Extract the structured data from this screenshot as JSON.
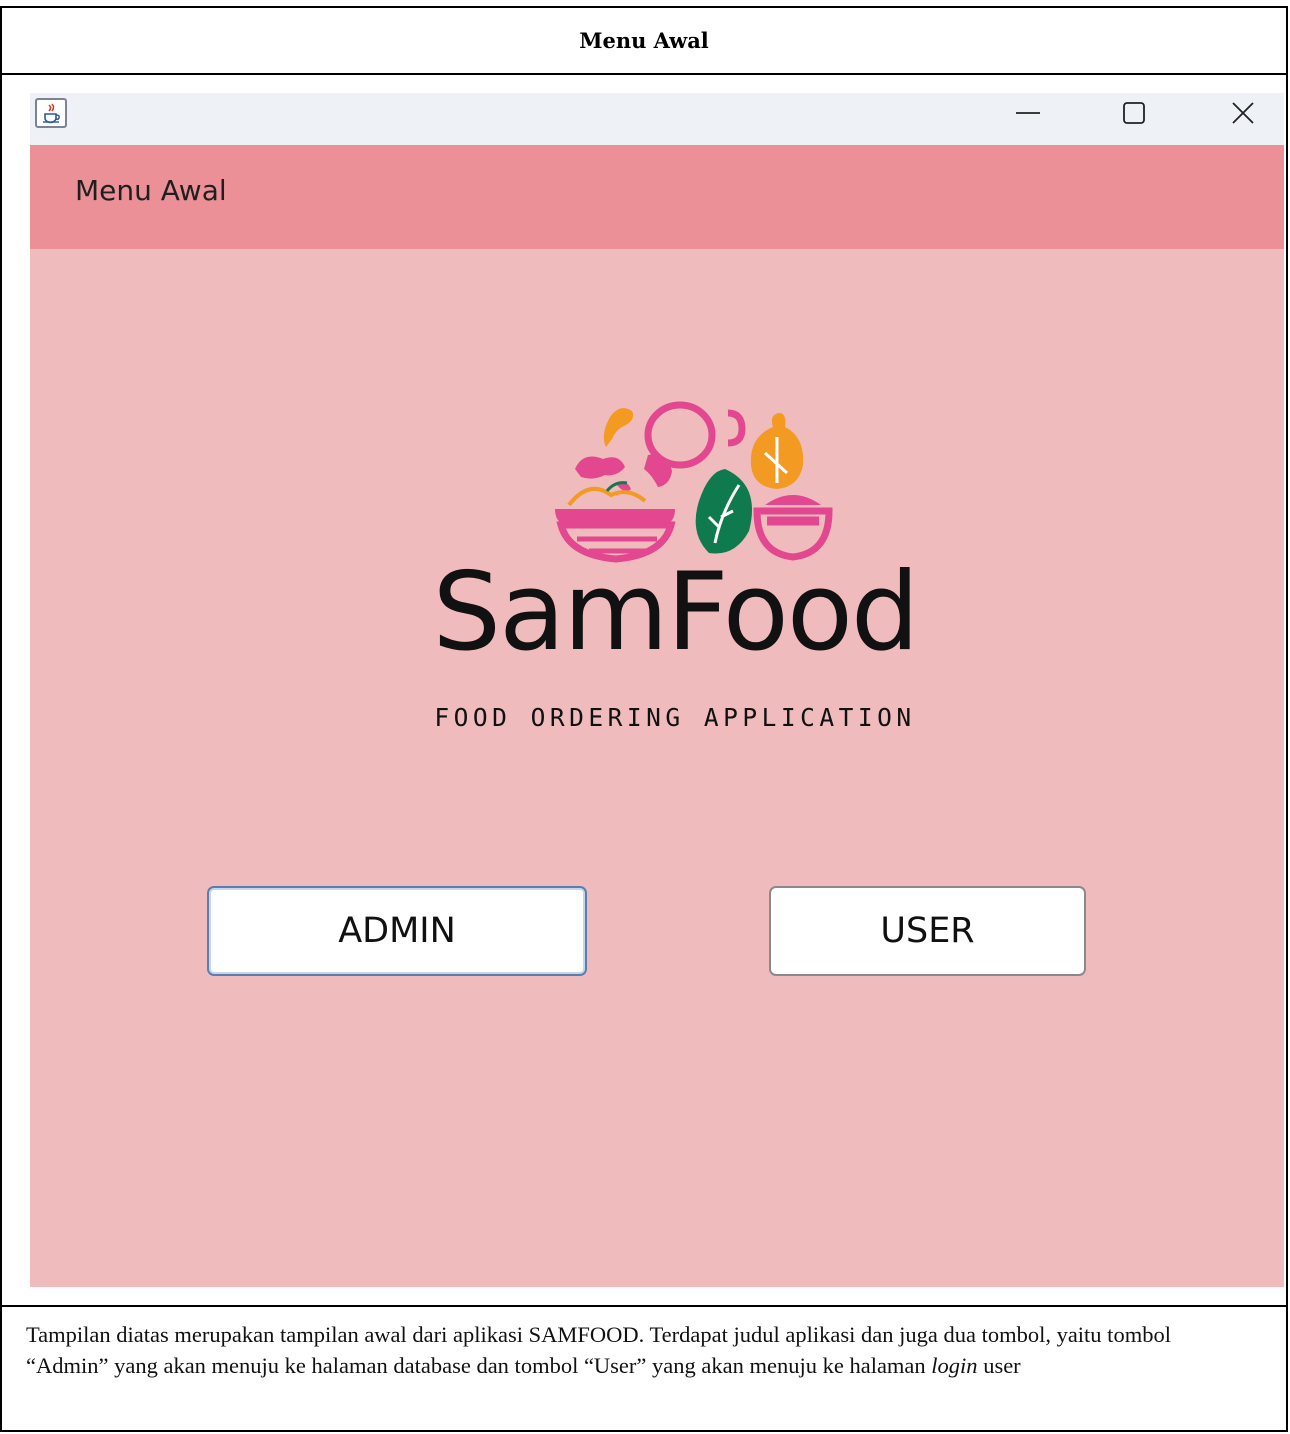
{
  "document": {
    "title": "Menu Awal",
    "description": {
      "part1": "Tampilan diatas merupakan tampilan awal dari aplikasi SAMFOOD. Terdapat judul aplikasi dan juga dua tombol,  yaitu tombol “Admin” yang akan menuju ke halaman database dan tombol “User” yang akan menuju ke halaman ",
      "italic": "login",
      "part2": " user"
    }
  },
  "window": {
    "titlebar_icon": "java-cup-icon",
    "controls": [
      "minimize-icon",
      "maximize-icon",
      "close-icon"
    ],
    "header_label": "Menu Awal",
    "logo": {
      "name": "SamFood",
      "tagline": "FOOD ORDERING APPLICATION"
    },
    "buttons": {
      "admin": "ADMIN",
      "user": "USER"
    }
  },
  "colors": {
    "header_band": "#ec9097",
    "body_bg": "#efbbbd",
    "titlebar_bg": "#eef1f5",
    "logo_pink": "#e2478f",
    "logo_orange": "#f39a23",
    "logo_green": "#0f7a4e"
  }
}
